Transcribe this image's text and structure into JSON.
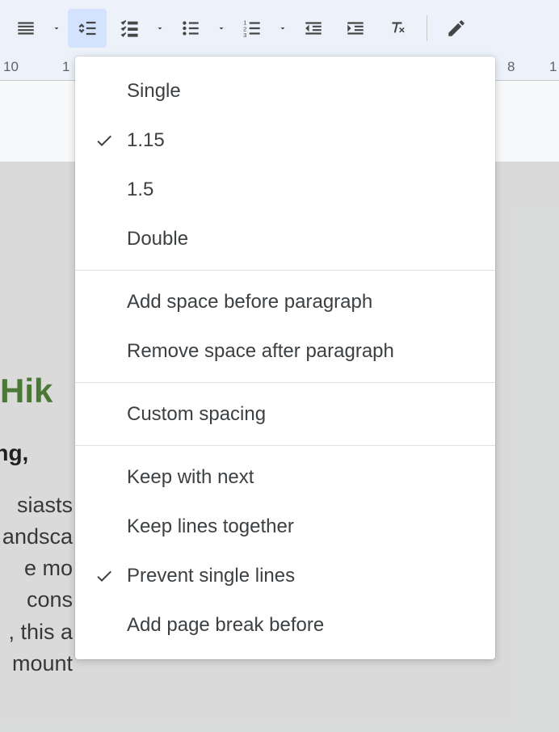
{
  "toolbar": {
    "buttons": [
      "align-lines",
      "line-spacing",
      "checklist",
      "bullet-list",
      "numbered-list",
      "outdent",
      "indent",
      "clear-formatting",
      "edit-mode"
    ]
  },
  "ruler": {
    "marks": [
      "10",
      "1",
      "8",
      "1"
    ]
  },
  "document": {
    "title": "Hik",
    "subtitle": "lling, a",
    "body_lines": [
      "siasts",
      "andsca",
      "e mo",
      "cons",
      ", this a",
      "mount"
    ]
  },
  "menu": {
    "section1": [
      {
        "label": "Single",
        "checked": false
      },
      {
        "label": "1.15",
        "checked": true
      },
      {
        "label": "1.5",
        "checked": false
      },
      {
        "label": "Double",
        "checked": false
      }
    ],
    "section2": [
      {
        "label": "Add space before paragraph",
        "checked": false
      },
      {
        "label": "Remove space after paragraph",
        "checked": false
      }
    ],
    "section3": [
      {
        "label": "Custom spacing",
        "checked": false
      }
    ],
    "section4": [
      {
        "label": "Keep with next",
        "checked": false
      },
      {
        "label": "Keep lines together",
        "checked": false
      },
      {
        "label": "Prevent single lines",
        "checked": true
      },
      {
        "label": "Add page break before",
        "checked": false
      }
    ]
  }
}
